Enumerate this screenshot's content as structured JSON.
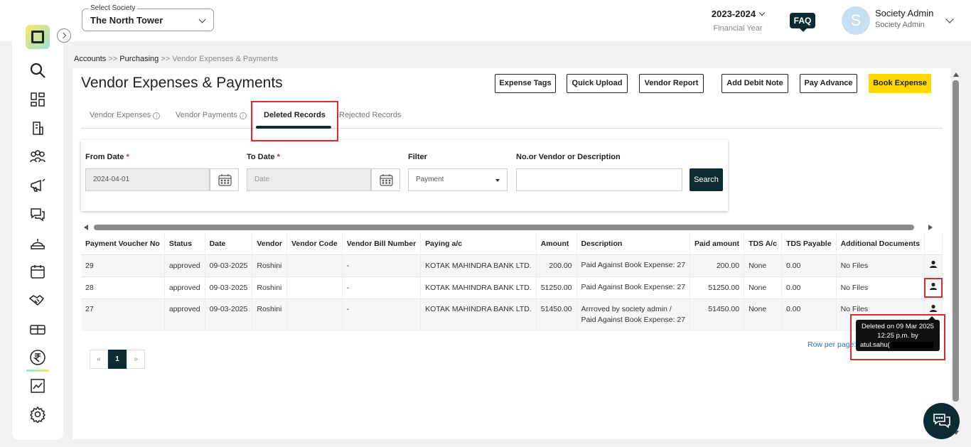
{
  "header": {
    "society_label": "Select Society",
    "society_value": "The North Tower",
    "financial_year": "2023-2024",
    "financial_year_label": "Financial Year",
    "faq": "FAQ",
    "avatar_letter": "S",
    "user_name": "Society Admin",
    "user_role": "Society Admin"
  },
  "sidebar": {
    "icons": [
      "search-icon",
      "dashboard-icon",
      "building-icon",
      "members-icon",
      "announcement-icon",
      "chat-icon",
      "helpdesk-icon",
      "calendar-icon",
      "handshake-icon",
      "amenity-icon",
      "rupee-icon",
      "report-icon",
      "settings-icon"
    ]
  },
  "breadcrumb": {
    "accounts": "Accounts",
    "sep1": ">>",
    "purchasing": "Purchasing",
    "sep2": ">>",
    "current": "Vendor Expenses & Payments"
  },
  "page": {
    "title": "Vendor Expenses & Payments",
    "buttons": {
      "expense_tags": "Expense Tags",
      "quick_upload": "Quick Upload",
      "vendor_report": "Vendor Report",
      "add_debit_note": "Add Debit Note",
      "pay_advance": "Pay Advance",
      "book_expense": "Book Expense"
    },
    "tabs": {
      "vendor_expenses": "Vendor Expenses",
      "vendor_payments": "Vendor Payments",
      "deleted_records": "Deleted Records",
      "rejected_records": "Rejected Records"
    }
  },
  "filters": {
    "from_date_label": "From Date",
    "from_date_value": "2024-04-01",
    "to_date_label": "To Date",
    "to_date_placeholder": "Date",
    "filter_label": "Filter",
    "filter_value": "Payment",
    "search_label": "No.or Vendor or Description",
    "search_value": "",
    "search_button": "Search",
    "required_mark": "*"
  },
  "table": {
    "headers": {
      "voucher": "Payment Voucher No",
      "status": "Status",
      "date": "Date",
      "vendor": "Vendor",
      "vendor_code": "Vendor Code",
      "bill_number": "Vendor Bill Number",
      "paying_ac": "Paying a/c",
      "amount": "Amount",
      "description": "Description",
      "paid_amount": "Paid amount",
      "tds_ac": "TDS A/c",
      "tds_payable": "TDS Payable",
      "additional_docs": "Additional Documents"
    },
    "rows": [
      {
        "voucher": "29",
        "status": "approved",
        "date": "09-03-2025",
        "vendor": "Roshini",
        "vendor_code": "",
        "bill_number": "-",
        "paying_ac": "KOTAK MAHINDRA BANK LTD.",
        "amount": "200.00",
        "description_1": "Paid Against Book Expense: 27",
        "description_2": "",
        "paid_amount": "200.00",
        "tds_ac": "None",
        "tds_payable": "0.00",
        "additional_docs": "No Files"
      },
      {
        "voucher": "28",
        "status": "approved",
        "date": "09-03-2025",
        "vendor": "Roshini",
        "vendor_code": "",
        "bill_number": "-",
        "paying_ac": "KOTAK MAHINDRA BANK LTD.",
        "amount": "51250.00",
        "description_1": "Paid Against Book Expense: 27",
        "description_2": "",
        "paid_amount": "51250.00",
        "tds_ac": "None",
        "tds_payable": "0.00",
        "additional_docs": "No Files"
      },
      {
        "voucher": "27",
        "status": "approved",
        "date": "09-03-2025",
        "vendor": "Roshini",
        "vendor_code": "",
        "bill_number": "-",
        "paying_ac": "KOTAK MAHINDRA BANK LTD.",
        "amount": "51450.00",
        "description_1": "Arrroved by society admin /",
        "description_2": "Paid Against Book Expense: 27",
        "paid_amount": "51450.00",
        "tds_ac": "None",
        "tds_payable": "0.00",
        "additional_docs": "No Files"
      }
    ]
  },
  "tooltip": {
    "line1": "Deleted on 09 Mar 2025",
    "line2": "12:25 p.m. by",
    "user": "atul.sahu("
  },
  "pagination": {
    "prev": "«",
    "current": "1",
    "next": "»",
    "row_per_page": "Row per page:"
  },
  "colors": {
    "primary_dark": "#0d2b32",
    "accent_yellow": "#ffd800",
    "highlight_red": "#d92b2b"
  }
}
